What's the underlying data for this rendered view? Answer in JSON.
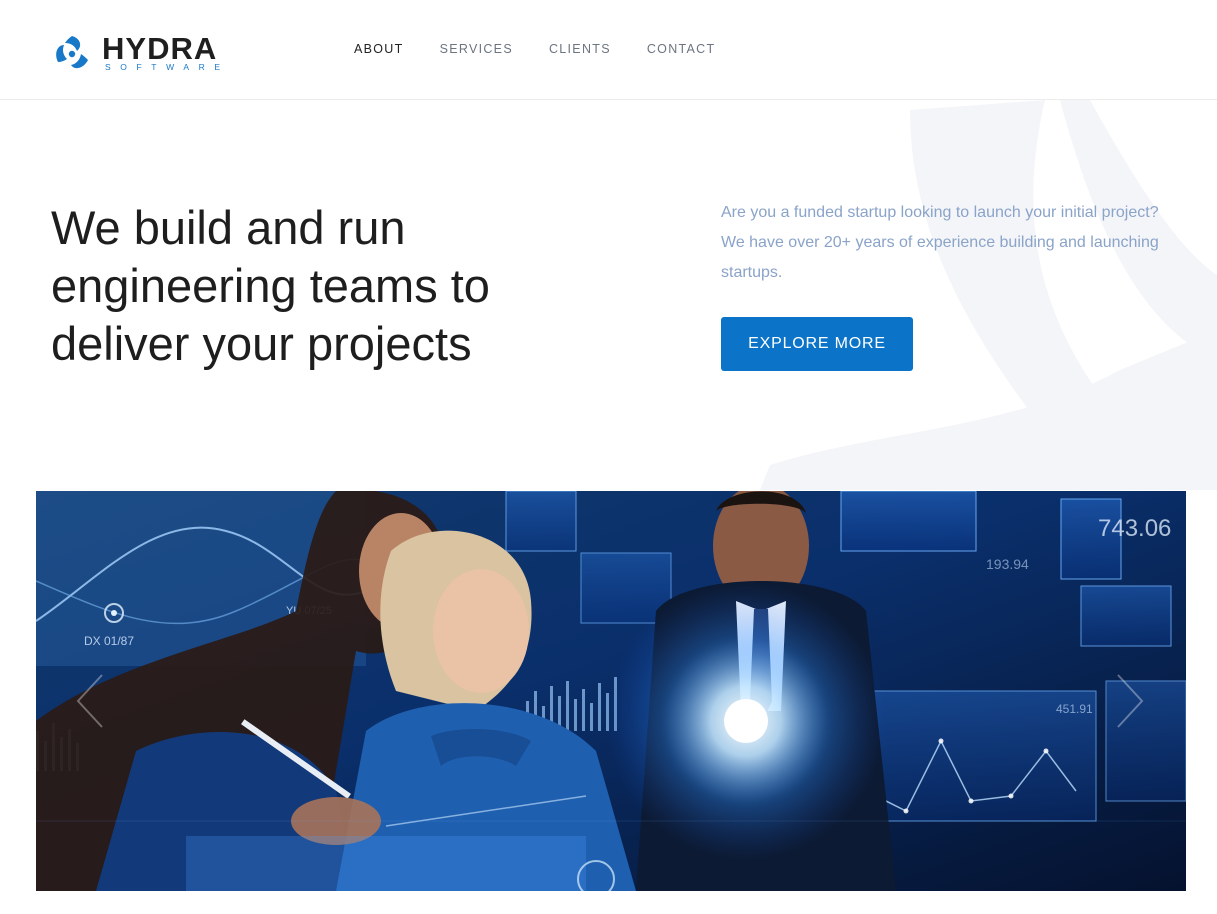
{
  "brand": {
    "name": "HYDRA",
    "tagline": "SOFTWARE",
    "colors": {
      "accent": "#0b74c8",
      "logo_blue": "#1979c9",
      "body_text": "#8aa3c9"
    }
  },
  "nav": {
    "items": [
      {
        "label": "ABOUT",
        "active": true
      },
      {
        "label": "SERVICES",
        "active": false
      },
      {
        "label": "CLIENTS",
        "active": false
      },
      {
        "label": "CONTACT",
        "active": false
      }
    ]
  },
  "hero": {
    "title": "We build and run engineering teams to deliver your projects",
    "copy": "Are you a funded startup looking to launch your initial project? We have over 20+ years of experience building and launching startups.",
    "cta_label": "EXPLORE MORE"
  },
  "banner": {
    "prev_icon": "chevron-left-icon",
    "next_icon": "chevron-right-icon",
    "hud_readouts": [
      "743.06",
      "193.94",
      "451.91",
      "DX 01/87",
      "YU 07/25"
    ]
  }
}
